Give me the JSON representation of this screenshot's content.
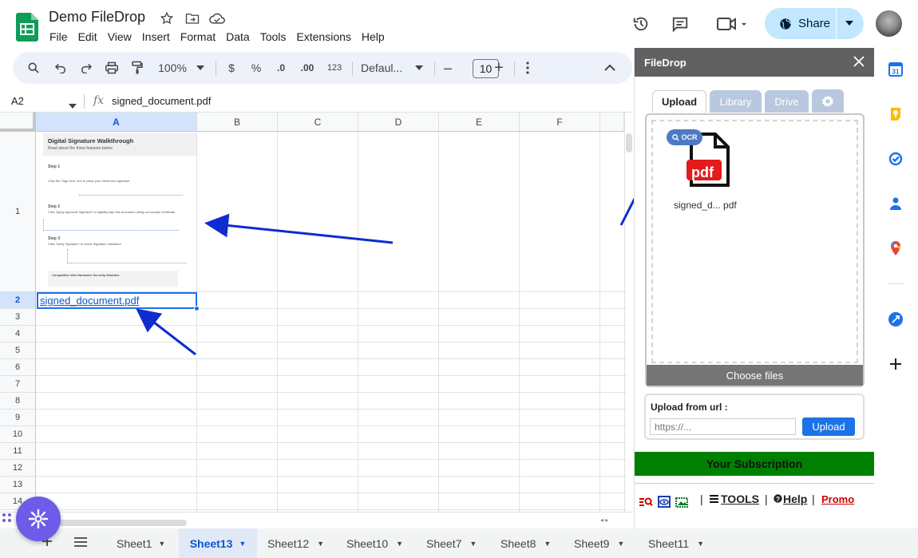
{
  "app": {
    "title": "Demo FileDrop"
  },
  "menu": [
    "File",
    "Edit",
    "View",
    "Insert",
    "Format",
    "Data",
    "Tools",
    "Extensions",
    "Help"
  ],
  "header": {
    "share_label": "Share"
  },
  "toolbar": {
    "zoom": "100%",
    "currency": "$",
    "percent": "%",
    "dec_decrease": ".0",
    "dec_increase": ".00",
    "number_format": "123",
    "font": "Defaul...",
    "font_size": "10"
  },
  "formula_bar": {
    "cell_ref": "A2",
    "fx": "fx",
    "content": "signed_document.pdf"
  },
  "grid": {
    "columns": [
      "A",
      "B",
      "C",
      "D",
      "E",
      "F"
    ],
    "rows": [
      "1",
      "2",
      "3",
      "4",
      "5",
      "6",
      "7",
      "8",
      "9",
      "10",
      "11",
      "12",
      "13",
      "14"
    ],
    "cell_a2": "signed_document.pdf",
    "thumbnail": {
      "title": "Digital Signature Walkthrough",
      "subtitle": "Read about the three features below",
      "step1": "Step 1",
      "step2": "Step 2",
      "step3": "Step 3",
      "step1_text": "Click the 'Sign here' box to place your electronic signature",
      "step2_text": "Click 'Apply Approval Signature' to digitally sign this document using our sample certificate",
      "step3_text": "Click 'Verify Signature' to check Signature validation",
      "footer_title": "Compatible with Hardware Security Modules"
    }
  },
  "sidebar": {
    "title": "FileDrop",
    "tabs": [
      "Upload",
      "Library",
      "Drive"
    ],
    "ocr_badge": "OCR",
    "pdf_label": "pdf",
    "file_name": "signed_d... pdf",
    "choose_files": "Choose files",
    "url_label": "Upload from url :",
    "url_placeholder": "https://...",
    "upload_button": "Upload",
    "subscription": "Your Subscription",
    "tools_label": "TOOLS",
    "help_label": "Help",
    "promo_label": "Promo",
    "sep": "|"
  },
  "sheets": [
    "Sheet1",
    "Sheet13",
    "Sheet12",
    "Sheet10",
    "Sheet7",
    "Sheet8",
    "Sheet9",
    "Sheet11"
  ],
  "active_sheet": "Sheet13",
  "colors": {
    "accent": "#1a73e8",
    "share_bg": "#c2e7ff",
    "subscription": "#008000",
    "promo": "#cc0000",
    "arrow": "#0f2ccf"
  }
}
